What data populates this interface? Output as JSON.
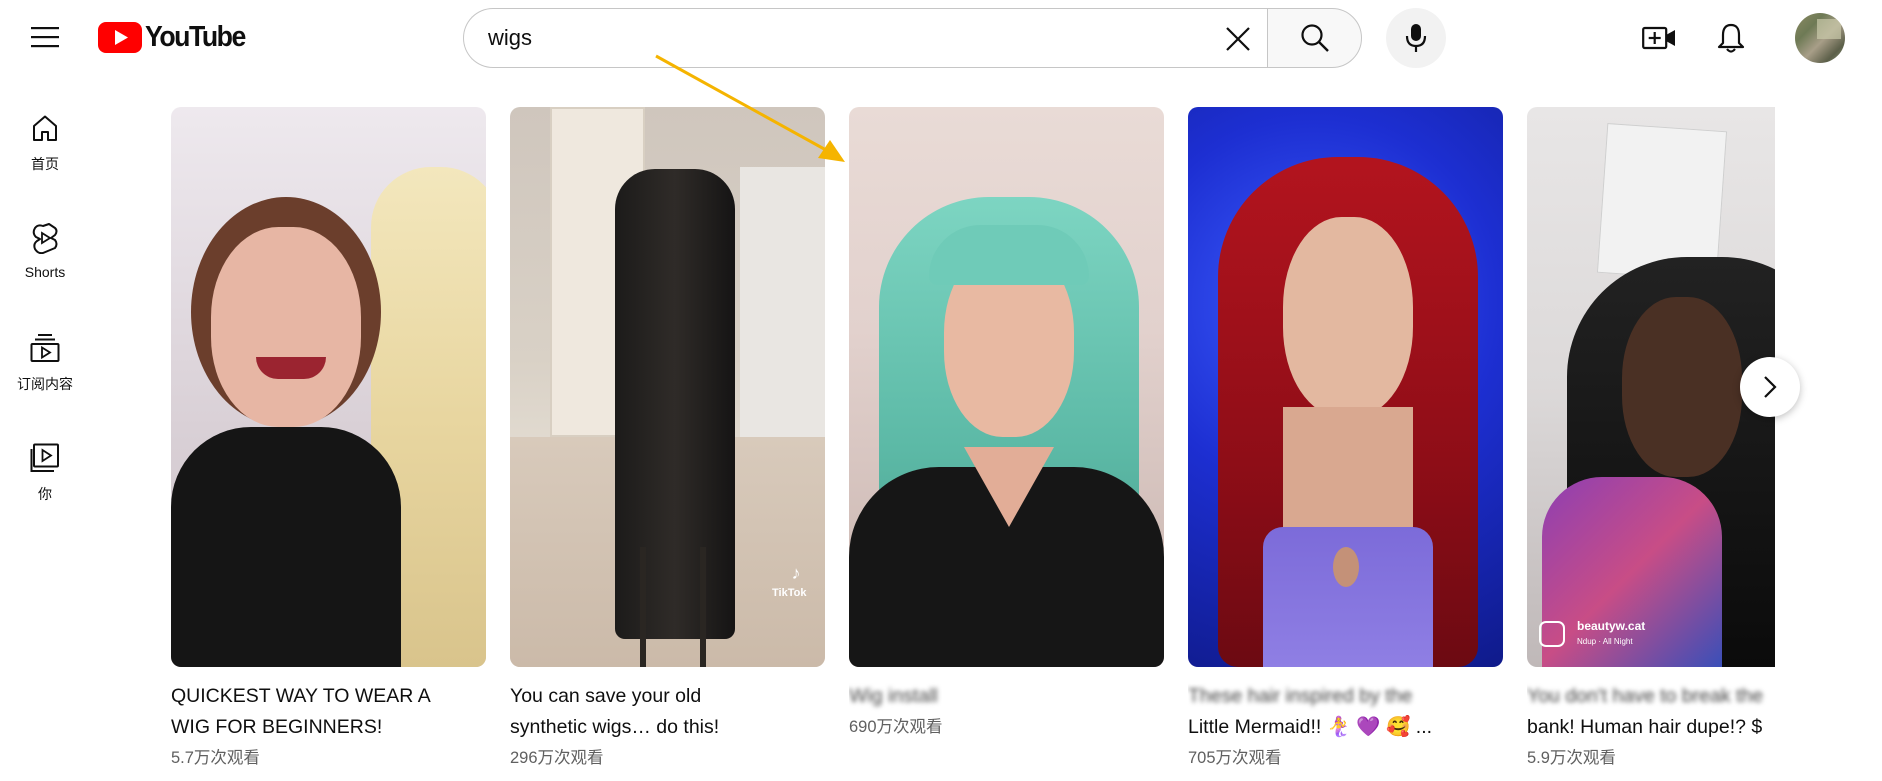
{
  "app": {
    "logo_text": "YouTube",
    "brand_color": "#ff0000"
  },
  "search": {
    "value": "wigs"
  },
  "masthead": {
    "icons": [
      "menu-icon",
      "clear-icon",
      "search-icon",
      "mic-icon",
      "create-icon",
      "bell-icon",
      "avatar"
    ]
  },
  "guide": {
    "items": [
      {
        "label": "首页",
        "icon": "home-icon"
      },
      {
        "label": "Shorts",
        "icon": "shorts-icon"
      },
      {
        "label": "订阅内容",
        "icon": "subscriptions-icon"
      },
      {
        "label": "你",
        "icon": "you-icon"
      }
    ]
  },
  "shorts": [
    {
      "title_line1": "QUICKEST WAY TO WEAR A",
      "title_line2": "WIG FOR BEGINNERS!",
      "views": "5.7万次观看"
    },
    {
      "title_line1": "You can save your old",
      "title_line2": "synthetic wigs… do this!",
      "views": "296万次观看",
      "watermark": "TikTok"
    },
    {
      "title_line1": "Wig install",
      "title_line2": "",
      "views": "690万次观看"
    },
    {
      "title_line1": "These hair inspired by the",
      "title_line2": "Little Mermaid!! 🧜‍♀️ 💜 🥰 ...",
      "views": "705万次观看"
    },
    {
      "title_line1": "You don't have to break the",
      "title_line2": "bank! Human hair dupe!? $",
      "views": "5.9万次观看",
      "watermark_user": "beautyw.cat",
      "watermark_sub": "Ndup · All Night"
    }
  ],
  "colors": {
    "text_secondary": "#606060",
    "arrow": "#f5b400"
  }
}
